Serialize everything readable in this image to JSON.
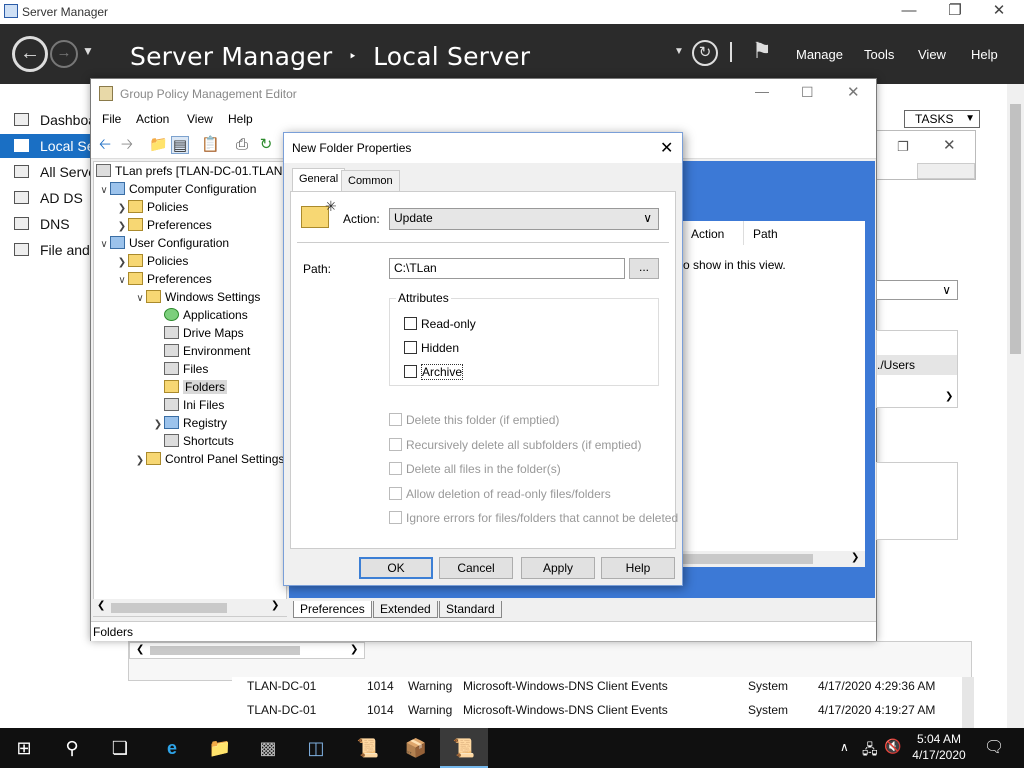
{
  "server_manager": {
    "window_title": "Server Manager",
    "breadcrumb": {
      "app": "Server Manager",
      "separator": "‣",
      "page": "Local Server"
    },
    "header_menu": {
      "manage": "Manage",
      "tools": "Tools",
      "view": "View",
      "help": "Help"
    },
    "nav": [
      {
        "label": "Dashboard",
        "icon": "dashboard-icon"
      },
      {
        "label": "Local Server",
        "icon": "server-icon",
        "active": true
      },
      {
        "label": "All Servers",
        "icon": "servers-icon"
      },
      {
        "label": "AD DS",
        "icon": "ad-ds-icon"
      },
      {
        "label": "DNS",
        "icon": "dns-icon"
      },
      {
        "label": "File and Storage Services",
        "icon": "file-storage-icon"
      }
    ],
    "tasks_label": "TASKS",
    "events": [
      {
        "server": "TLAN-DC-01",
        "id": "1014",
        "severity": "Warning",
        "source": "Microsoft-Windows-DNS Client Events",
        "log": "System",
        "date": "4/17/2020 4:29:36 AM"
      },
      {
        "server": "TLAN-DC-01",
        "id": "1014",
        "severity": "Warning",
        "source": "Microsoft-Windows-DNS Client Events",
        "log": "System",
        "date": "4/17/2020 4:19:27 AM"
      }
    ]
  },
  "gpme": {
    "title": "Group Policy Management Editor",
    "menu": {
      "file": "File",
      "action": "Action",
      "view": "View",
      "help": "Help"
    },
    "tree": {
      "root": "TLan prefs [TLAN-DC-01.TLAN.",
      "computer_config": "Computer Configuration",
      "cc_policies": "Policies",
      "cc_preferences": "Preferences",
      "user_config": "User Configuration",
      "uc_policies": "Policies",
      "uc_preferences": "Preferences",
      "windows_settings": "Windows Settings",
      "applications": "Applications",
      "drive_maps": "Drive Maps",
      "environment": "Environment",
      "files": "Files",
      "folders": "Folders",
      "ini_files": "Ini Files",
      "registry": "Registry",
      "shortcuts": "Shortcuts",
      "control_panel": "Control Panel Settings"
    },
    "right_columns": {
      "action": "Action",
      "path": "Path"
    },
    "right_message": "o show in this view.",
    "right_fragment": "./Users",
    "bottom_tabs": {
      "preferences": "Preferences",
      "extended": "Extended",
      "standard": "Standard"
    },
    "status": "Folders"
  },
  "dialog": {
    "title": "New Folder Properties",
    "tabs": {
      "general": "General",
      "common": "Common"
    },
    "action_label": "Action:",
    "action_value": "Update",
    "path_label": "Path:",
    "path_value": "C:\\TLan",
    "browse_label": "...",
    "attributes_legend": "Attributes",
    "attributes": [
      {
        "label": "Read-only",
        "checked": false
      },
      {
        "label": "Hidden",
        "checked": false
      },
      {
        "label": "Archive",
        "checked": false
      }
    ],
    "options": [
      {
        "label": "Delete this folder (if emptied)",
        "checked": false,
        "enabled": false
      },
      {
        "label": "Recursively delete all subfolders (if emptied)",
        "checked": false,
        "enabled": false
      },
      {
        "label": "Delete all files in the folder(s)",
        "checked": false,
        "enabled": false
      },
      {
        "label": "Allow deletion of read-only files/folders",
        "checked": false,
        "enabled": false
      },
      {
        "label": "Ignore errors for files/folders that cannot be deleted",
        "checked": false,
        "enabled": false
      }
    ],
    "buttons": {
      "ok": "OK",
      "cancel": "Cancel",
      "apply": "Apply",
      "help": "Help"
    }
  },
  "taskbar": {
    "time": "5:04 AM",
    "date": "4/17/2020"
  },
  "colors": {
    "accent": "#1a6fc4",
    "header_bg": "#2b2b2b",
    "pane_blue": "#3c79d6",
    "taskbar_bg": "#101010"
  }
}
